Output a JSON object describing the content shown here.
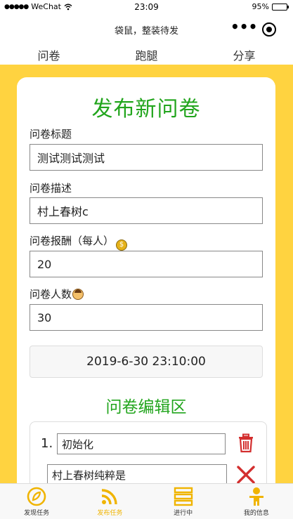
{
  "status_bar": {
    "signal": "●●●●●",
    "carrier": "WeChat",
    "time": "23:09",
    "battery": "95%",
    "battery_level": 0.95
  },
  "nav_bar": {
    "title": "袋鼠，整装待发",
    "more": "•••"
  },
  "top_tabs": [
    {
      "label": "问卷",
      "active": true
    },
    {
      "label": "跑腿",
      "active": false
    },
    {
      "label": "分享",
      "active": false
    }
  ],
  "form": {
    "title": "发布新问卷",
    "title_field": {
      "label": "问卷标题",
      "value": "测试测试测试"
    },
    "desc_field": {
      "label": "问卷描述",
      "value": "村上春树c"
    },
    "reward_field": {
      "label": "问卷报酬（每人）",
      "value": "20"
    },
    "count_field": {
      "label": "问卷人数",
      "value": "30"
    },
    "deadline": "2019-6-30 23:10:00"
  },
  "editor": {
    "title": "问卷编辑区",
    "questions": [
      {
        "number": "1.",
        "text": "初始化",
        "options": [
          "村上春树纯粹是"
        ]
      }
    ]
  },
  "tab_bar": [
    {
      "label": "发现任务",
      "icon": "discover-icon",
      "active": false
    },
    {
      "label": "发布任务",
      "icon": "rss-icon",
      "active": true
    },
    {
      "label": "进行中",
      "icon": "list-icon",
      "active": false
    },
    {
      "label": "我的信息",
      "icon": "person-icon",
      "active": false
    }
  ],
  "colors": {
    "accent_yellow": "#ffd340",
    "title_green": "#22a51d",
    "delete_red": "#d32f2f",
    "tab_active": "#f0b400"
  }
}
